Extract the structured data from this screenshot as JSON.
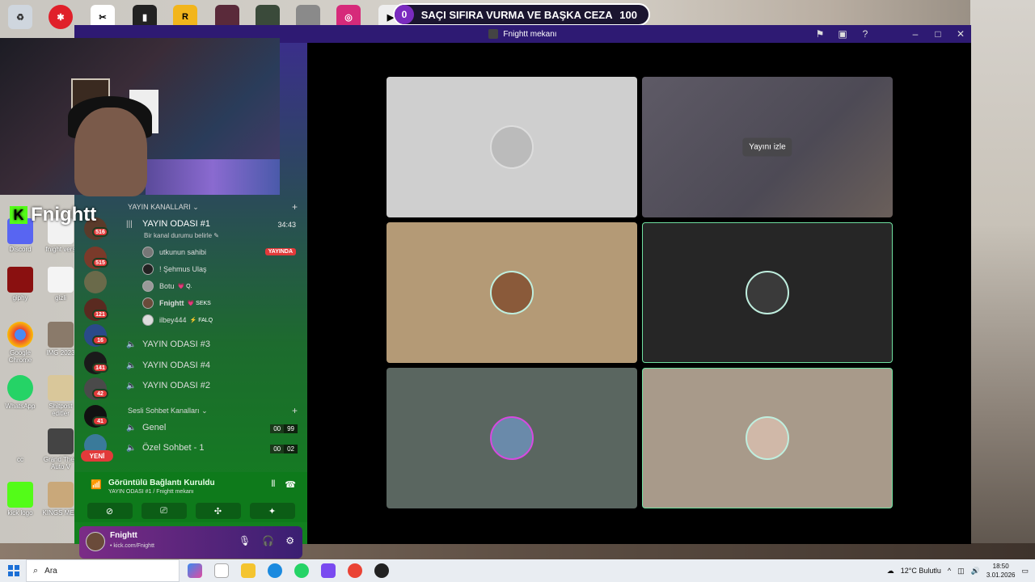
{
  "banner": {
    "left_value": "0",
    "text": "SAÇI SIFIRA VURMA VE BAŞKA CEZA",
    "right_value": "100"
  },
  "window": {
    "title": "Fnightt mekanı"
  },
  "overlay": {
    "kick_name": "Fnightt"
  },
  "sidebar": {
    "server_badges": [
      "516",
      "515",
      "121",
      "16",
      "141",
      "42",
      "41"
    ],
    "new_label": "YENİ",
    "cat_stream": "YAYIN KANALLARI",
    "active_channel": {
      "name": "YAYIN ODASI #1",
      "time": "34:43",
      "status": "Bir kanal durumu belirle"
    },
    "members": [
      {
        "name": "utkunun sahibi",
        "tag": "",
        "live": "YAYINDA"
      },
      {
        "name": "! Şehmus Ulaş",
        "tag": ""
      },
      {
        "name": "Botu",
        "tag": "💗 Q."
      },
      {
        "name": "Fnightt",
        "tag": "💗 SEKS"
      },
      {
        "name": "ilbey444",
        "tag": "⚡ FALQ"
      }
    ],
    "channels": [
      "YAYIN ODASI #3",
      "YAYIN ODASI #4",
      "YAYIN ODASI #2"
    ],
    "cat_voice": "Sesli Sohbet Kanalları",
    "voice_channels": [
      {
        "name": "Genel",
        "count_a": "00",
        "count_b": "99"
      },
      {
        "name": "Özel Sohbet - 1",
        "count_a": "00",
        "count_b": "02"
      }
    ]
  },
  "voice_panel": {
    "title": "Görüntülü Bağlantı Kuruldu",
    "subtitle": "YAYIN ODASI #1 / Fnightt mekanı"
  },
  "user_panel": {
    "name": "Fnightt",
    "status": "• kick.com/Fnightt"
  },
  "grid": {
    "watch_label": "Yayını izle"
  },
  "taskbar": {
    "search_placeholder": "Ara",
    "weather": "12°C  Bulutlu",
    "time": "18:50",
    "date": "3.01.2026"
  },
  "colors": {
    "accent_green": "#11821d",
    "kick_green": "#53fc18",
    "title_purple": "#2e1a73",
    "live_red": "#e23a3a"
  }
}
